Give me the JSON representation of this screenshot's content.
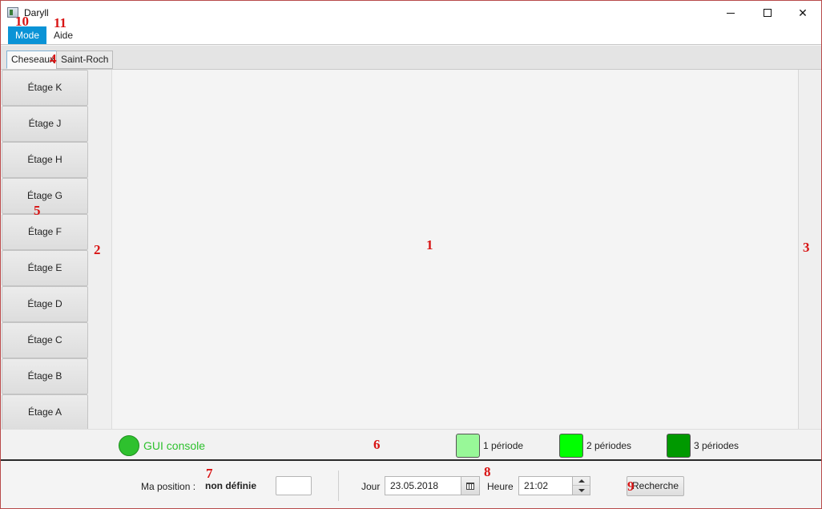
{
  "window": {
    "title": "Daryll"
  },
  "menu": [
    {
      "label": "Mode",
      "active": true
    },
    {
      "label": "Aide",
      "active": false
    }
  ],
  "tabs": [
    {
      "label": "Cheseaux",
      "selected": true
    },
    {
      "label": "Saint-Roch",
      "selected": false
    }
  ],
  "floors": [
    "Étage K",
    "Étage J",
    "Étage H",
    "Étage G",
    "Étage F",
    "Étage E",
    "Étage D",
    "Étage C",
    "Étage B",
    "Étage A"
  ],
  "legend": {
    "console_label": "GUI console",
    "console_color": "#2ec12e",
    "items": [
      {
        "label": "1 période",
        "color": "#98f898"
      },
      {
        "label": "2 périodes",
        "color": "#00ff00"
      },
      {
        "label": "3 périodes",
        "color": "#009900"
      }
    ]
  },
  "position": {
    "label": "Ma position :",
    "value": "non définie",
    "input_value": ""
  },
  "datetime": {
    "jour_label": "Jour",
    "date": "23.05.2018",
    "heure_label": "Heure",
    "time": "21:02"
  },
  "search": {
    "label": "Recherche"
  },
  "annotations": [
    "1",
    "2",
    "3",
    "4",
    "5",
    "6",
    "7",
    "8",
    "9",
    "10",
    "11"
  ],
  "colors": {
    "accent": "#0a93d6",
    "marker": "#d81414"
  }
}
